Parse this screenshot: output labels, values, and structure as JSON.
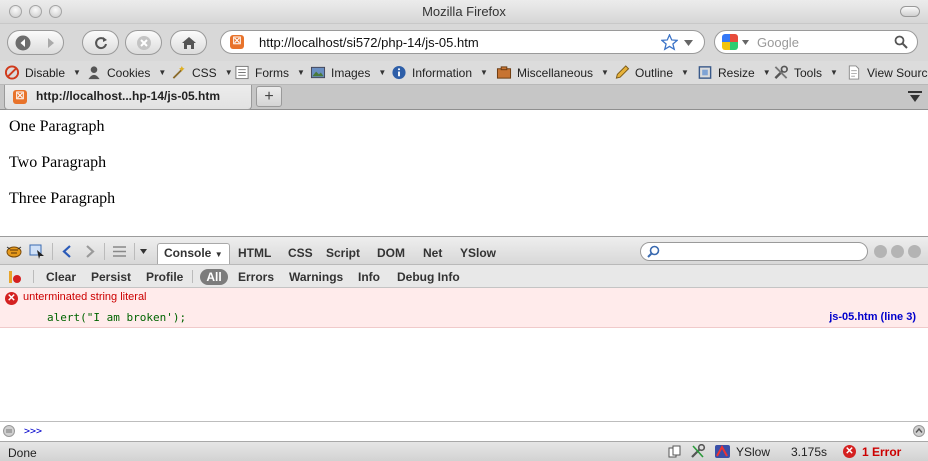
{
  "window": {
    "title": "Mozilla Firefox"
  },
  "nav": {
    "url": "http://localhost/si572/php-14/js-05.htm",
    "search_placeholder": "Google"
  },
  "devbar": {
    "items": [
      "Disable",
      "Cookies",
      "CSS",
      "Forms",
      "Images",
      "Information",
      "Miscellaneous",
      "Outline",
      "Resize",
      "Tools",
      "View Source"
    ]
  },
  "tabs": [
    {
      "label": "http://localhost...hp-14/js-05.htm"
    }
  ],
  "page": {
    "paragraphs": [
      "One Paragraph",
      "Two Paragraph",
      "Three Paragraph"
    ]
  },
  "firebug": {
    "panels": [
      "Console",
      "HTML",
      "CSS",
      "Script",
      "DOM",
      "Net",
      "YSlow"
    ],
    "console_buttons": [
      "Clear",
      "Persist",
      "Profile"
    ],
    "filters": [
      "All",
      "Errors",
      "Warnings",
      "Info",
      "Debug Info"
    ],
    "error": {
      "message": "unterminated string literal",
      "source": "alert(\"I am broken');",
      "location": "js-05.htm (line 3)"
    },
    "prompt": ">>>"
  },
  "status": {
    "text": "Done",
    "yslow": "YSlow",
    "time": "3.175s",
    "errors": "1 Error"
  },
  "colors": {
    "error_bg": "#ffebeb",
    "error_text": "#cc0000",
    "link": "#0000cc"
  }
}
